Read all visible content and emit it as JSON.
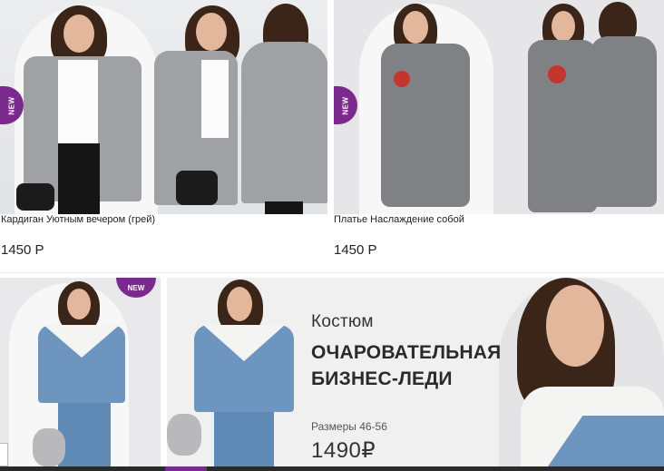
{
  "products": [
    {
      "name": "Кардиган Уютным вечером (грей)",
      "price": "1450 Р",
      "badge": "NEW"
    },
    {
      "name": "Платье Наслаждение собой",
      "price": "1450 Р",
      "badge": "NEW"
    }
  ],
  "bottom_product": {
    "badge": "NEW"
  },
  "promo": {
    "title": "Костюм",
    "headline_line1": "ОЧАРОВАТЕЛЬНАЯ",
    "headline_line2": "БИЗНЕС-ЛЕДИ",
    "sizes": "Размеры 46-56",
    "price": "1490₽"
  },
  "colors": {
    "brand_badge": "#7a2a8c",
    "text": "#222222"
  },
  "icons": [
    "new-badge"
  ]
}
